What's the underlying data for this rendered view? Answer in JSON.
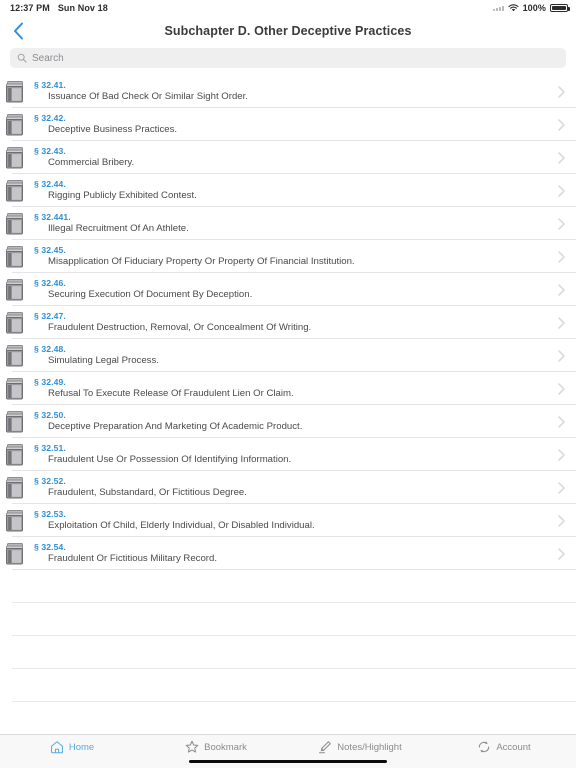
{
  "status_bar": {
    "time": "12:37 PM",
    "date": "Sun Nov 18",
    "battery_percent": "100%",
    "wifi_icon": "wifi-icon",
    "battery_icon": "battery-icon",
    "signal_icon": "signal-dots-icon"
  },
  "nav": {
    "back_icon": "chevron-left-icon",
    "title": "Subchapter D. Other Deceptive Practices",
    "accent_color": "#2f8fd8"
  },
  "search": {
    "placeholder": "Search",
    "value": "",
    "icon": "search-icon"
  },
  "list": {
    "row_icon": "books-stack-icon",
    "disclosure_icon": "chevron-right-icon",
    "items": [
      {
        "section": "§ 32.41.",
        "title": "Issuance Of Bad Check Or Similar Sight Order."
      },
      {
        "section": "§ 32.42.",
        "title": "Deceptive Business Practices."
      },
      {
        "section": "§ 32.43.",
        "title": "Commercial Bribery."
      },
      {
        "section": "§ 32.44.",
        "title": "Rigging Publicly Exhibited Contest."
      },
      {
        "section": "§ 32.441.",
        "title": "Illegal Recruitment Of An Athlete."
      },
      {
        "section": "§ 32.45.",
        "title": "Misapplication Of Fiduciary Property Or Property Of Financial Institution."
      },
      {
        "section": "§ 32.46.",
        "title": "Securing Execution Of Document By Deception."
      },
      {
        "section": "§ 32.47.",
        "title": "Fraudulent Destruction, Removal, Or Concealment Of Writing."
      },
      {
        "section": "§ 32.48.",
        "title": "Simulating Legal Process."
      },
      {
        "section": "§ 32.49.",
        "title": "Refusal To Execute Release Of Fraudulent Lien Or Claim."
      },
      {
        "section": "§ 32.50.",
        "title": "Deceptive Preparation And Marketing Of Academic Product."
      },
      {
        "section": "§ 32.51.",
        "title": "Fraudulent Use Or Possession Of Identifying Information."
      },
      {
        "section": "§ 32.52.",
        "title": "Fraudulent, Substandard, Or Fictitious Degree."
      },
      {
        "section": "§ 32.53.",
        "title": "Exploitation Of Child, Elderly Individual, Or Disabled Individual."
      },
      {
        "section": "§ 32.54.",
        "title": "Fraudulent Or Fictitious Military Record."
      }
    ],
    "empty_row_count": 5
  },
  "tabbar": {
    "active_index": 0,
    "active_color": "#5ca9e0",
    "inactive_color": "#8b8b90",
    "tabs": [
      {
        "label": "Home",
        "icon": "home-icon"
      },
      {
        "label": "Bookmark",
        "icon": "star-icon"
      },
      {
        "label": "Notes/Highlight",
        "icon": "highlighter-pen-icon"
      },
      {
        "label": "Account",
        "icon": "sync-circle-icon"
      }
    ]
  }
}
